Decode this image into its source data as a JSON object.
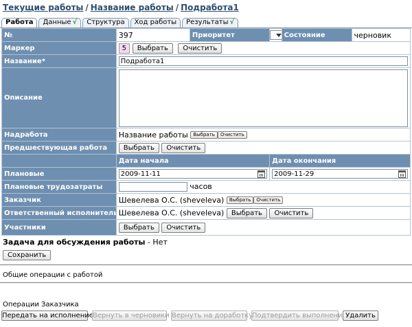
{
  "breadcrumb": [
    "Текущие работы",
    "Название работы",
    "Подработа1"
  ],
  "breadcrumb_sep": "/",
  "tabs": [
    {
      "label": "Работа",
      "active": true,
      "checked": false
    },
    {
      "label": "Данные",
      "active": false,
      "checked": true
    },
    {
      "label": "Структура",
      "active": false,
      "checked": false
    },
    {
      "label": "Ход работы",
      "active": false,
      "checked": false
    },
    {
      "label": "Результаты",
      "active": false,
      "checked": true
    }
  ],
  "check_glyph": "√",
  "form": {
    "number_label": "№",
    "number_value": "397",
    "priority_label": "Приоритет",
    "status_label": "Состояние",
    "status_value": "черновик",
    "marker_label": "Маркер",
    "marker_value": "5",
    "name_label": "Название*",
    "name_value": "Подработа1",
    "description_label": "Описание",
    "parent_label": "Надработа",
    "parent_value": "Название работы",
    "previous_label": "Предшествующая работа",
    "start_header": "Дата начала",
    "end_header": "Дата окончания",
    "planned_label": "Плановые",
    "start_value": "2009-11-11",
    "end_value": "2009-11-29",
    "labor_label": "Плановые трудозатраты",
    "labor_unit": "часов",
    "customer_label": "Заказчик",
    "customer_value": "Шевелева О.С. (sheveleva)",
    "executor_label": "Ответственный исполнитель",
    "executor_value": "Шевелева О.С. (sheveleva)",
    "participants_label": "Участники"
  },
  "buttons": {
    "choose": "Выбрать",
    "clear": "Очистить",
    "save": "Сохранить",
    "submit": "Передать на исполнение",
    "to_draft": "Вернуть в черновики",
    "to_rework": "Вернуть на доработку",
    "confirm": "Подтвердить выполнение",
    "delete": "Удалить"
  },
  "discussion_label": "Задача для обсуждения работы",
  "discussion_value": "- Нет",
  "general_ops_title": "Общие операции с работой",
  "customer_ops_title": "Операции Заказчика"
}
